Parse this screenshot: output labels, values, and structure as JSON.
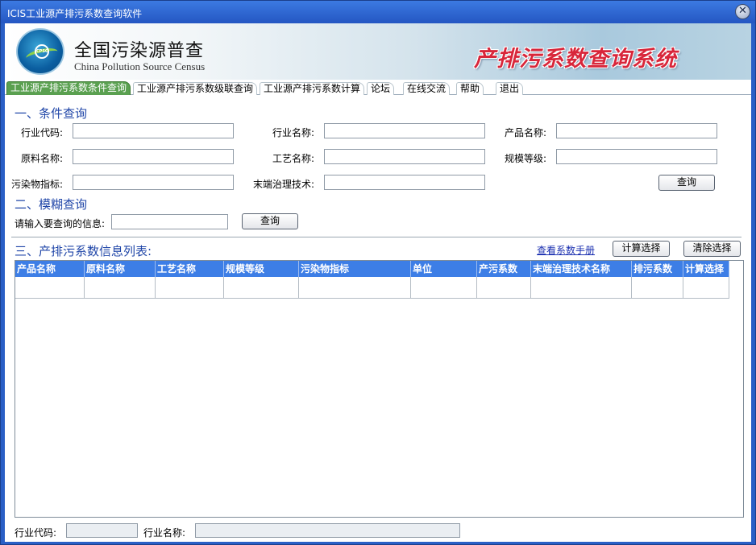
{
  "window": {
    "title": "ICIS工业源产排污系数查询软件",
    "close_symbol": "✕"
  },
  "banner": {
    "logo_text": "CPSC",
    "brand_cn": "全国污染源普查",
    "brand_en": "China Pollution Source Census",
    "system_title": "产排污系数查询系统"
  },
  "tabs": [
    {
      "label": "工业源产排污系数条件查询",
      "active": true
    },
    {
      "label": "工业源产排污系数级联查询",
      "active": false
    },
    {
      "label": "工业源产排污系数计算",
      "active": false
    },
    {
      "label": "论坛",
      "active": false
    },
    {
      "label": "在线交流",
      "active": false
    },
    {
      "label": "帮助",
      "active": false
    },
    {
      "label": "退出",
      "active": false
    }
  ],
  "condition_query": {
    "title": "一、条件查询",
    "industry_code_label": "行业代码:",
    "industry_name_label": "行业名称:",
    "product_name_label": "产品名称:",
    "material_name_label": "原料名称:",
    "process_name_label": "工艺名称:",
    "scale_level_label": "规模等级:",
    "pollutant_label": "污染物指标:",
    "treatment_label": "末端治理技术:",
    "query_button": "查询",
    "values": {
      "industry_code": "",
      "industry_name": "",
      "product_name": "",
      "material_name": "",
      "process_name": "",
      "scale_level": "",
      "pollutant": "",
      "treatment": ""
    }
  },
  "fuzzy_query": {
    "title": "二、模糊查询",
    "prompt_label": "请输入要查询的信息:",
    "value": "",
    "query_button": "查询"
  },
  "result_list": {
    "title": "三、产排污系数信息列表:",
    "manual_link": "查看系数手册",
    "calc_button": "计算选择",
    "clear_button": "清除选择",
    "columns": [
      "产品名称",
      "原料名称",
      "工艺名称",
      "规模等级",
      "污染物指标",
      "单位",
      "产污系数",
      "末端治理技术名称",
      "排污系数",
      "计算选择"
    ]
  },
  "status": {
    "industry_code_label": "行业代码:",
    "industry_name_label": "行业名称:"
  }
}
